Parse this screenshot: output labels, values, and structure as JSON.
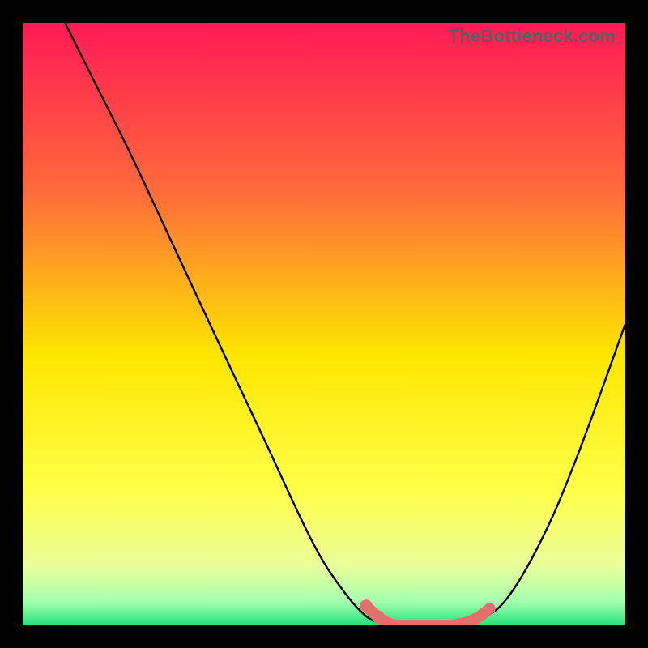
{
  "watermark": "TheBottleneck.com",
  "colors": {
    "black": "#000000",
    "curve": "#000000",
    "marker": "#e46f6d",
    "grad_top": "#ff1a56",
    "grad_mid1": "#ff7a2a",
    "grad_mid2": "#ffe600",
    "grad_mid3": "#f6ff66",
    "grad_mid4": "#d6ffb0",
    "grad_bot": "#23e27a"
  },
  "chart_data": {
    "type": "line",
    "title": "",
    "xlabel": "",
    "ylabel": "",
    "xlim": [
      0,
      100
    ],
    "ylim": [
      0,
      100
    ],
    "series": [
      {
        "name": "bottleneck-curve-left",
        "x": [
          7,
          12,
          18,
          25,
          32,
          40,
          48,
          53,
          57,
          60
        ],
        "values": [
          100,
          90,
          78,
          63,
          48,
          31,
          14,
          6,
          1.5,
          0.2
        ]
      },
      {
        "name": "bottleneck-curve-flat",
        "x": [
          60,
          63,
          66,
          69,
          72,
          75
        ],
        "values": [
          0.2,
          0,
          0,
          0,
          0,
          0.5
        ]
      },
      {
        "name": "bottleneck-curve-right",
        "x": [
          75,
          80,
          86,
          92,
          100
        ],
        "values": [
          0.5,
          4,
          14,
          28,
          50
        ]
      }
    ],
    "markers": {
      "name": "highlight-points",
      "x": [
        57,
        59,
        61,
        63,
        65,
        67,
        69,
        71,
        73,
        74.5,
        76,
        77.5
      ],
      "values": [
        3.2,
        1.4,
        0.2,
        0,
        0,
        0,
        0,
        0,
        0.3,
        0.8,
        1.6,
        2.8
      ]
    }
  }
}
